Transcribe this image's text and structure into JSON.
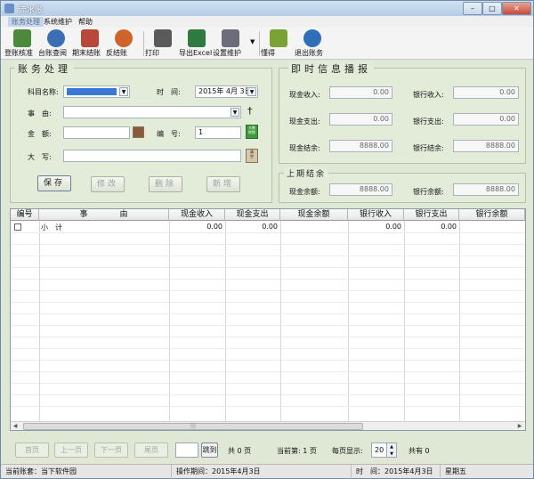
{
  "window": {
    "title": "流水账",
    "min": "–",
    "max": "□",
    "close": "✕"
  },
  "menu": [
    {
      "label": "账务处理",
      "selected": true
    },
    {
      "label": "系统维护",
      "selected": false
    },
    {
      "label": "帮助",
      "selected": false
    }
  ],
  "toolbar": [
    {
      "label": "登账核准",
      "icon": "approve-icon",
      "color": "#4a8a3a"
    },
    {
      "label": "台账查阅",
      "icon": "magnifier-icon",
      "color": "#3b6fb5"
    },
    {
      "label": "期末结账",
      "icon": "checklist-icon",
      "color": "#b9483a"
    },
    {
      "label": "反结账",
      "icon": "refresh-icon",
      "color": "#d0632a"
    },
    {
      "label": "打印",
      "icon": "printer-icon",
      "color": "#5a5a5a"
    },
    {
      "label": "导出Excel",
      "icon": "export-excel-icon",
      "color": "#2f7a3f"
    },
    {
      "label": "设置维护",
      "icon": "settings-icon",
      "color": "#6c6c7a"
    },
    {
      "label": "懂得",
      "icon": "understand-icon",
      "color": "#7aa334"
    },
    {
      "label": "退出账务",
      "icon": "exit-icon",
      "color": "#2f6fb8"
    }
  ],
  "entry": {
    "title": "账务处理",
    "subject_label": "科目名称:",
    "subject_value": "",
    "time_label": "时　间:",
    "time_value": "2015年 4月 3日",
    "matter_label": "事　由:",
    "matter_value": "",
    "amount_label": "金　额:",
    "amount_value": "",
    "number_label": "编　号:",
    "number_value": "1",
    "upper_label": "大　写:",
    "upper_value": "",
    "digits_badge": "大数\n转换",
    "clear_badge": "清\n空",
    "buttons": {
      "save": "保存",
      "edit": "修改",
      "delete": "删除",
      "add": "新增"
    }
  },
  "info": {
    "title": "即时信息播报",
    "cash_in_label": "现金收入:",
    "cash_in": "0.00",
    "bank_in_label": "银行收入:",
    "bank_in": "0.00",
    "cash_out_label": "现金支出:",
    "cash_out": "0.00",
    "bank_out_label": "银行支出:",
    "bank_out": "0.00",
    "cash_bal_label": "现金结余:",
    "cash_bal": "8888.00",
    "bank_bal_label": "银行结余:",
    "bank_bal": "8888.00"
  },
  "last": {
    "title": "上期结余",
    "cash_label": "现金余额:",
    "cash": "8888.00",
    "bank_label": "银行余额:",
    "bank": "8888.00"
  },
  "table": {
    "columns": [
      "编号",
      "事　　　　由",
      "现金收入",
      "现金支出",
      "现金余额",
      "银行收入",
      "银行支出",
      "银行余额"
    ],
    "rows": [
      {
        "no": "",
        "matter": "小　计",
        "cash_in": "0.00",
        "cash_out": "0.00",
        "cash_bal": "",
        "bank_in": "0.00",
        "bank_out": "0.00",
        "bank_bal": ""
      }
    ]
  },
  "pager": {
    "first": "首页",
    "prev": "上一页",
    "next": "下一页",
    "last": "尾页",
    "goto_value": "",
    "goto": "跳到",
    "total_pages": "共 0 页",
    "current": "当前第: 1 页",
    "per_page_label": "每页显示:",
    "per_page": "20",
    "total_label": "共有 0"
  },
  "status": {
    "account": "当前账套：当下软件园",
    "op_date": "操作期间：2015年4月3日",
    "time": "时　间：2015年4月3日",
    "weekday": "星期五"
  }
}
